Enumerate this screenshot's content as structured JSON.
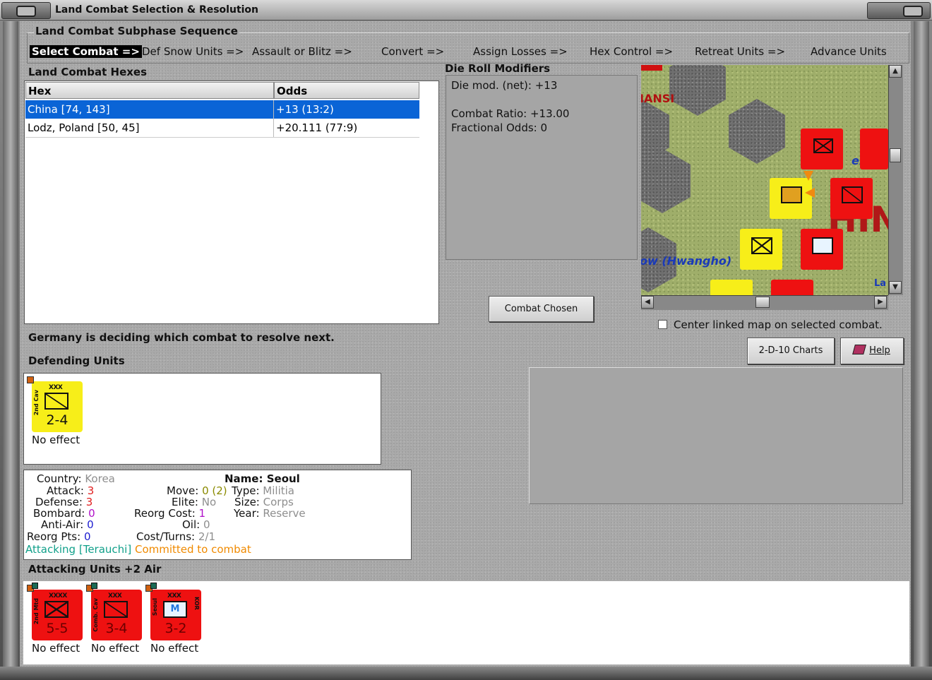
{
  "window": {
    "title": "Land Combat Selection & Resolution"
  },
  "sequence": {
    "title": "Land Combat Subphase Sequence",
    "steps": [
      "Select Combat =>",
      "Def Snow Units =>",
      "Assault or Blitz =>",
      "Convert =>",
      "Assign Losses =>",
      "Hex Control =>",
      "Retreat Units =>",
      "Advance Units"
    ]
  },
  "hexes": {
    "title": "Land Combat Hexes",
    "columns": [
      "Hex",
      "Odds"
    ],
    "rows": [
      {
        "hex": "China [74, 143]",
        "odds": "+13 (13:2)"
      },
      {
        "hex": "Lodz, Poland [50, 45]",
        "odds": "+20.111 (77:9)"
      }
    ]
  },
  "modifiers": {
    "title": "Die Roll Modifiers",
    "lines": [
      "Die mod. (net): +13",
      "Combat Ratio: +13.00",
      "Fractional Odds: 0"
    ]
  },
  "map": {
    "labels": [
      "IANSI",
      "ow (Hwangho)",
      "ell",
      "HIN",
      "La"
    ]
  },
  "buttons": {
    "combat_chosen": "Combat Chosen",
    "charts": "2-D-10 Charts",
    "help": "Help"
  },
  "center_checkbox": {
    "label": "Center linked map on selected combat.",
    "checked": false
  },
  "status": "Germany is deciding which combat to resolve next.",
  "defending": {
    "title": "Defending Units",
    "units": [
      {
        "name": "2nd Cav",
        "size": "XXX",
        "value": "2-4",
        "effect": "No effect",
        "color": "#f7ee19"
      }
    ]
  },
  "details": {
    "country_label": "Country:",
    "country": "Korea",
    "attack_label": "Attack:",
    "attack": "3",
    "defense_label": "Defense:",
    "defense": "3",
    "bombard_label": "Bombard:",
    "bombard": "0",
    "antiair_label": "Anti-Air:",
    "antiair": "0",
    "reorgpts_label": "Reorg Pts:",
    "reorgpts": "0",
    "move_label": "Move:",
    "move": "0",
    "move_extra": "(2)",
    "elite_label": "Elite:",
    "elite": "No",
    "reorgcost_label": "Reorg Cost:",
    "reorgcost": "1",
    "oil_label": "Oil:",
    "oil": "0",
    "costturns_label": "Cost/Turns:",
    "costturns": "2/1",
    "name_label": "Name:",
    "name": "Seoul",
    "type_label": "Type:",
    "type": "Militia",
    "size_label": "Size:",
    "size": "Corps",
    "year_label": "Year:",
    "year": "Reserve",
    "attacking": "Attacking [Terauchi]",
    "committed": "Committed to combat"
  },
  "attacking": {
    "title": "Attacking Units +2 Air",
    "units": [
      {
        "name": "2nd Mtd",
        "size": "XXXX",
        "value": "5-5",
        "effect": "No effect",
        "color": "#ee1111"
      },
      {
        "name": "Comb. Cav",
        "size": "XXX",
        "value": "3-4",
        "effect": "No effect",
        "color": "#ee1111"
      },
      {
        "name": "Seoul",
        "side": "KOR",
        "size": "XXX",
        "value": "3-2",
        "effect": "No effect",
        "color": "#ee1111"
      }
    ]
  }
}
